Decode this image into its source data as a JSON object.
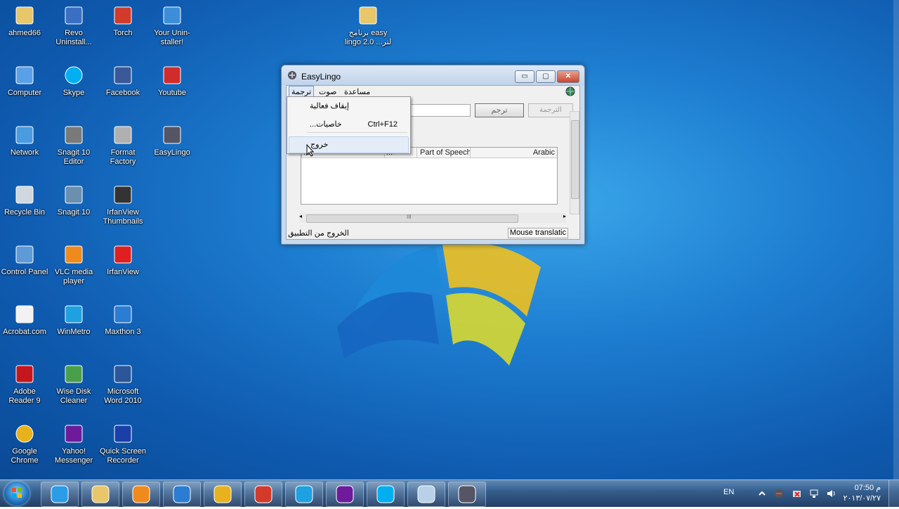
{
  "desktop": {
    "icons": [
      {
        "label": "ahmed66",
        "icon": "folder-icon"
      },
      {
        "label": "Revo Uninstall...",
        "icon": "revo-uninstaller-icon"
      },
      {
        "label": "Torch",
        "icon": "torch-icon"
      },
      {
        "label": "Your Unin-staller!",
        "icon": "your-uninstaller-icon"
      },
      {
        "label": "برنامج easy lingo 2.0 ...لتر",
        "icon": "folder-icon"
      },
      {
        "label": "Computer",
        "icon": "computer-icon"
      },
      {
        "label": "Skype",
        "icon": "skype-icon"
      },
      {
        "label": "Facebook",
        "icon": "facebook-icon"
      },
      {
        "label": "Youtube",
        "icon": "youtube-icon"
      },
      {
        "label": "Network",
        "icon": "network-icon"
      },
      {
        "label": "Snagit 10 Editor",
        "icon": "snagit-editor-icon"
      },
      {
        "label": "Format Factory",
        "icon": "format-factory-icon"
      },
      {
        "label": "EasyLingo",
        "icon": "easylingo-icon"
      },
      {
        "label": "Recycle Bin",
        "icon": "recycle-bin-icon"
      },
      {
        "label": "Snagit 10",
        "icon": "snagit-icon"
      },
      {
        "label": "IrfanView Thumbnails",
        "icon": "irfanview-thumbnails-icon"
      },
      {
        "label": "Control Panel",
        "icon": "control-panel-icon"
      },
      {
        "label": "VLC media player",
        "icon": "vlc-icon"
      },
      {
        "label": "IrfanView",
        "icon": "irfanview-icon"
      },
      {
        "label": "Acrobat.com",
        "icon": "acrobat-com-icon"
      },
      {
        "label": "WinMetro",
        "icon": "winmetro-icon"
      },
      {
        "label": "Maxthon 3",
        "icon": "maxthon-icon"
      },
      {
        "label": "Adobe Reader 9",
        "icon": "adobe-reader-icon"
      },
      {
        "label": "Wise Disk Cleaner",
        "icon": "wise-disk-cleaner-icon"
      },
      {
        "label": "Microsoft Word 2010",
        "icon": "word-icon"
      },
      {
        "label": "Google Chrome",
        "icon": "chrome-icon"
      },
      {
        "label": "Yahoo! Messenger",
        "icon": "yahoo-messenger-icon"
      },
      {
        "label": "Quick Screen Recorder",
        "icon": "quick-screen-recorder-icon"
      }
    ]
  },
  "window": {
    "title": "EasyLingo",
    "minimize": "▭",
    "maximize": "▢",
    "close": "✕",
    "menu": {
      "translate": "ترجمة",
      "sound": "صوت",
      "help": "مساعدة"
    },
    "toolbar": {
      "translate_button": "ترجم",
      "translation_label": "الترجمة"
    },
    "table_headers": [
      "...",
      "...",
      "Part of Speech",
      "Arabic"
    ],
    "scroll_grip": "III",
    "status_left": "الخروج من التطبيق",
    "status_right": "Mouse translatic"
  },
  "dropdown": {
    "items": [
      {
        "label": "إيقاف فعالية",
        "shortcut": ""
      },
      {
        "label": "...خاصيات",
        "shortcut": "Ctrl+F12"
      },
      {
        "label": "خروج",
        "shortcut": ""
      }
    ]
  },
  "taskbar": {
    "items": [
      "internet-explorer-icon",
      "explorer-icon",
      "media-player-icon",
      "maxthon-icon",
      "chrome-icon",
      "torch-icon",
      "winmetro-icon",
      "yahoo-messenger-icon",
      "skype-icon",
      "notepad-icon",
      "easylingo-icon"
    ],
    "language": "EN",
    "time": "07:50 م",
    "date": "٢٠١٣/٠٧/٢٧"
  }
}
